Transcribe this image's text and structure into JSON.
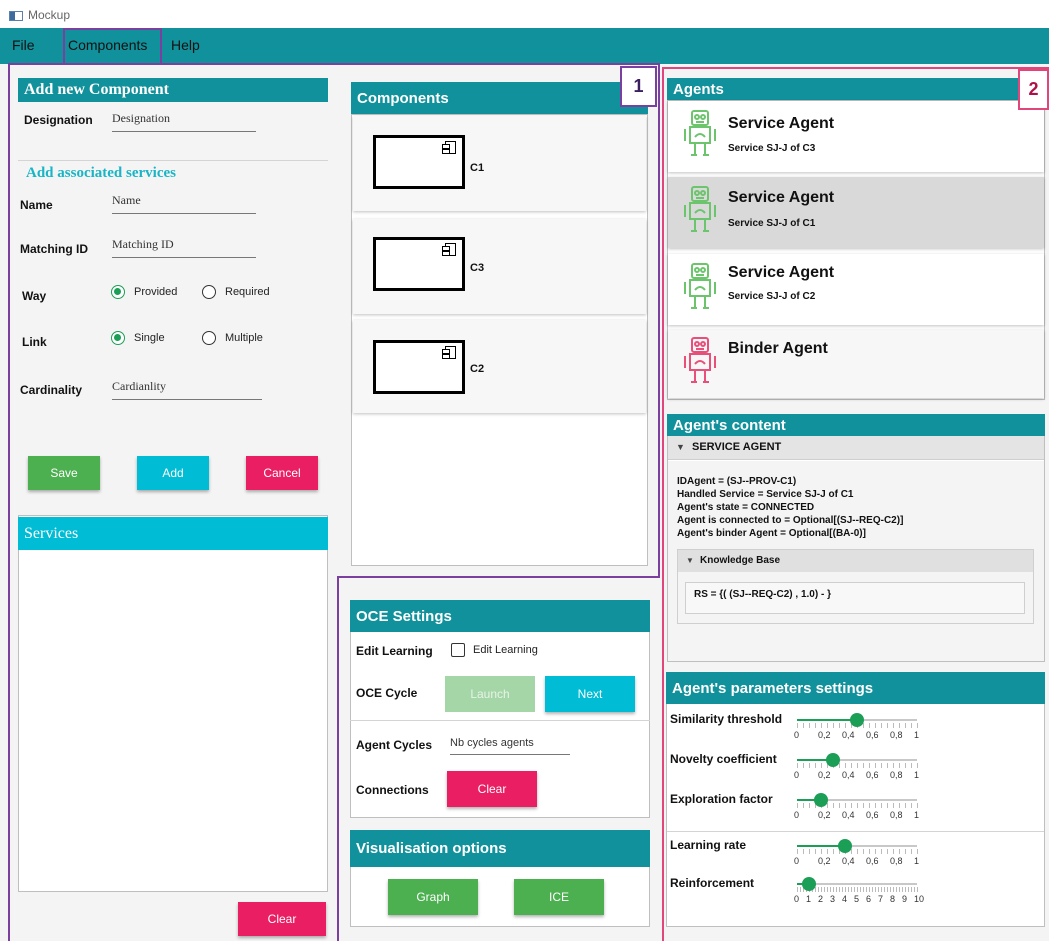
{
  "window": {
    "title": "Mockup"
  },
  "menu": {
    "file": "File",
    "components": "Components",
    "help": "Help"
  },
  "add_component": {
    "header": "Add new Component",
    "designation_label": "Designation",
    "designation_value": "Designation",
    "services_header": "Add associated services",
    "name_label": "Name",
    "name_value": "Name",
    "matching_label": "Matching ID",
    "matching_value": "Matching ID",
    "way_label": "Way",
    "provided": "Provided",
    "required": "Required",
    "link_label": "Link",
    "single": "Single",
    "multiple": "Multiple",
    "cardinality_label": "Cardinality",
    "cardinality_value": "Cardianlity",
    "save": "Save",
    "add": "Add",
    "cancel": "Cancel",
    "services_panel": "Services",
    "clear": "Clear"
  },
  "components": {
    "header": "Components",
    "items": [
      "C1",
      "C3",
      "C2"
    ],
    "badge": "1"
  },
  "oce": {
    "header": "OCE Settings",
    "edit_learning_label": "Edit Learning",
    "edit_learning_check": "Edit Learning",
    "cycle_label": "OCE Cycle",
    "launch": "Launch",
    "next": "Next",
    "agent_cycles_label": "Agent Cycles",
    "agent_cycles_value": "Nb cycles agents",
    "connections_label": "Connections",
    "clear": "Clear"
  },
  "visualisation": {
    "header": "Visualisation options",
    "graph": "Graph",
    "ice": "ICE"
  },
  "agents": {
    "header": "Agents",
    "badge": "2",
    "items": [
      {
        "title": "Service Agent",
        "subtitle": "Service SJ-J of C3"
      },
      {
        "title": "Service Agent",
        "subtitle": "Service SJ-J of C1"
      },
      {
        "title": "Service Agent",
        "subtitle": "Service SJ-J of C2"
      },
      {
        "title": "Binder Agent",
        "subtitle": ""
      }
    ]
  },
  "agent_content": {
    "header": "Agent's content",
    "section": "SERVICE AGENT",
    "lines": [
      "IDAgent = (SJ--PROV-C1)",
      "Handled Service  = Service SJ-J of C1",
      "Agent's state  = CONNECTED",
      "Agent is connected to  = Optional[(SJ--REQ-C2)]",
      "Agent's binder Agent  = Optional[(BA-0)]"
    ],
    "kb_header": "Knowledge Base",
    "kb_line": "RS = {( (SJ--REQ-C2) , 1.0) -  }"
  },
  "params": {
    "header": "Agent's parameters settings",
    "sliders": [
      {
        "label": "Similarity threshold",
        "value": 0.5,
        "ticks": [
          "0",
          "0,2",
          "0,4",
          "0,6",
          "0,8",
          "1"
        ]
      },
      {
        "label": "Novelty coefficient",
        "value": 0.3,
        "ticks": [
          "0",
          "0,2",
          "0,4",
          "0,6",
          "0,8",
          "1"
        ]
      },
      {
        "label": "Exploration factor",
        "value": 0.2,
        "ticks": [
          "0",
          "0,2",
          "0,4",
          "0,6",
          "0,8",
          "1"
        ]
      },
      {
        "label": "Learning rate",
        "value": 0.4,
        "ticks": [
          "0",
          "0,2",
          "0,4",
          "0,6",
          "0,8",
          "1"
        ]
      },
      {
        "label": "Reinforcement",
        "value": 1,
        "ticks": [
          "0",
          "1",
          "2",
          "3",
          "4",
          "5",
          "6",
          "7",
          "8",
          "9",
          "10"
        ]
      }
    ]
  },
  "colors": {
    "teal": "#11919b",
    "cyan": "#00bcd4",
    "green": "#4caf50",
    "pink": "#e91e63",
    "purple_outline": "#7b3fa0",
    "pink_outline": "#e0457b",
    "agent_green": "#6cc46c",
    "agent_pink": "#e8507a"
  },
  "icons": {
    "component": "component-icon",
    "agent": "robot-icon",
    "triangle": "triangle-down-icon"
  }
}
